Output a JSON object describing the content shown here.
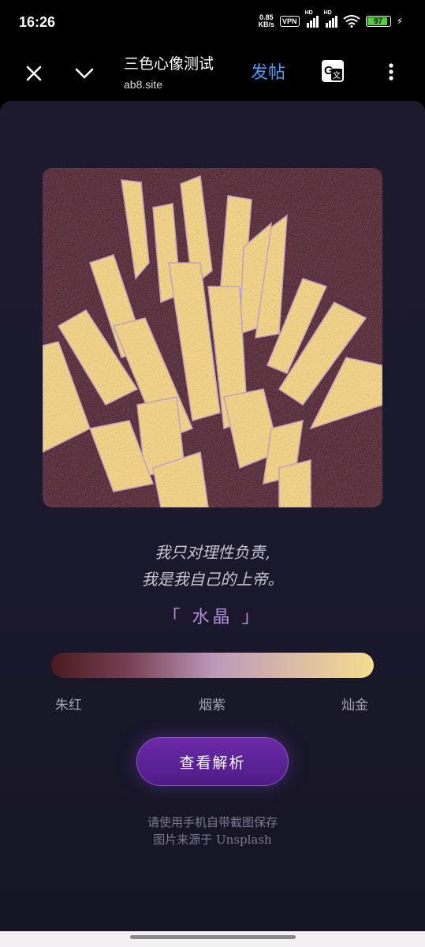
{
  "status_bar": {
    "time": "16:26",
    "net_speed_value": "0.85",
    "net_speed_unit": "KB/s",
    "vpn": "VPN",
    "signal_label": "HD",
    "battery_level": "97"
  },
  "app_bar": {
    "title": "三色心像测试",
    "url": "ab8.site",
    "post_label": "发帖"
  },
  "result": {
    "quote_line1": "我只对理性负责,",
    "quote_line2": "我是我自己的上帝。",
    "name": "「 水晶 」",
    "colors": [
      {
        "label": "朱红",
        "hex": "#4a1a20"
      },
      {
        "label": "烟紫",
        "hex": "#bb98b8"
      },
      {
        "label": "灿金",
        "hex": "#f5dc8e"
      }
    ],
    "button_label": "查看解析",
    "footer_line1": "请使用手机自带截图保存",
    "footer_line2": "图片来源于 Unsplash"
  },
  "theme": {
    "accent": "#4b9cf0",
    "button": "#5a2296",
    "background": "#1b1a2d"
  }
}
